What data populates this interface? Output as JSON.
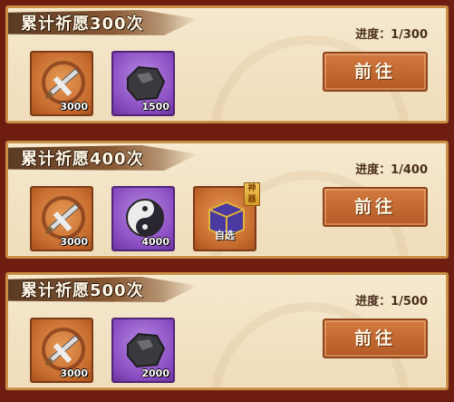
{
  "panels": [
    {
      "title": "累计祈愿300次",
      "progress": "进度：1/300",
      "button": "前往",
      "items": [
        {
          "icon": "sword-scroll-icon",
          "qty": "3000"
        },
        {
          "icon": "dark-ore-icon",
          "qty": "1500"
        }
      ]
    },
    {
      "title": "累计祈愿400次",
      "progress": "进度：1/400",
      "button": "前往",
      "items": [
        {
          "icon": "sword-scroll-icon",
          "qty": "3000"
        },
        {
          "icon": "yin-yang-icon",
          "qty": "4000"
        },
        {
          "icon": "treasure-box-icon",
          "label": "自选",
          "tag": "神器"
        }
      ]
    },
    {
      "title": "累计祈愿500次",
      "progress": "进度：1/500",
      "button": "前往",
      "items": [
        {
          "icon": "sword-scroll-icon",
          "qty": "3000"
        },
        {
          "icon": "dark-ore-icon",
          "qty": "2000"
        }
      ]
    }
  ]
}
